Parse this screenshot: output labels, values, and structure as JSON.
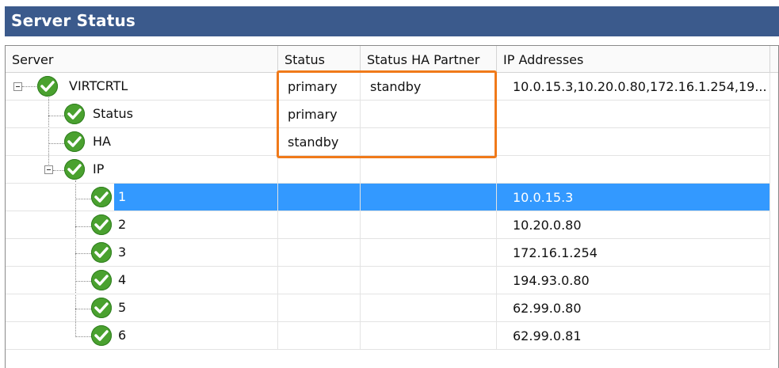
{
  "window": {
    "title": "Server Status"
  },
  "columns": [
    "Server",
    "Status",
    "Status HA Partner",
    "IP Addresses"
  ],
  "rows": [
    {
      "label": "VIRTCRTL",
      "status": "primary",
      "ha_partner": "standby",
      "ip": "10.0.15.3,10.20.0.80,172.16.1.254,19..."
    },
    {
      "label": "Status",
      "status": "primary",
      "ha_partner": "",
      "ip": ""
    },
    {
      "label": "HA",
      "status": "standby",
      "ha_partner": "",
      "ip": ""
    },
    {
      "label": "IP",
      "status": "",
      "ha_partner": "",
      "ip": ""
    },
    {
      "label": "1",
      "status": "",
      "ha_partner": "",
      "ip": "10.0.15.3"
    },
    {
      "label": "2",
      "status": "",
      "ha_partner": "",
      "ip": "10.20.0.80"
    },
    {
      "label": "3",
      "status": "",
      "ha_partner": "",
      "ip": "172.16.1.254"
    },
    {
      "label": "4",
      "status": "",
      "ha_partner": "",
      "ip": "194.93.0.80"
    },
    {
      "label": "5",
      "status": "",
      "ha_partner": "",
      "ip": "62.99.0.80"
    },
    {
      "label": "6",
      "status": "",
      "ha_partner": "",
      "ip": "62.99.0.81"
    }
  ],
  "selected_row": "1",
  "colors": {
    "title_bar": "#3b5a8c",
    "selection": "#3399ff",
    "status_ok": "#4aa12f",
    "highlight_box": "#f07a1a"
  },
  "icons": {
    "status": "check-circle-icon",
    "expand": "tree-collapse-icon"
  }
}
